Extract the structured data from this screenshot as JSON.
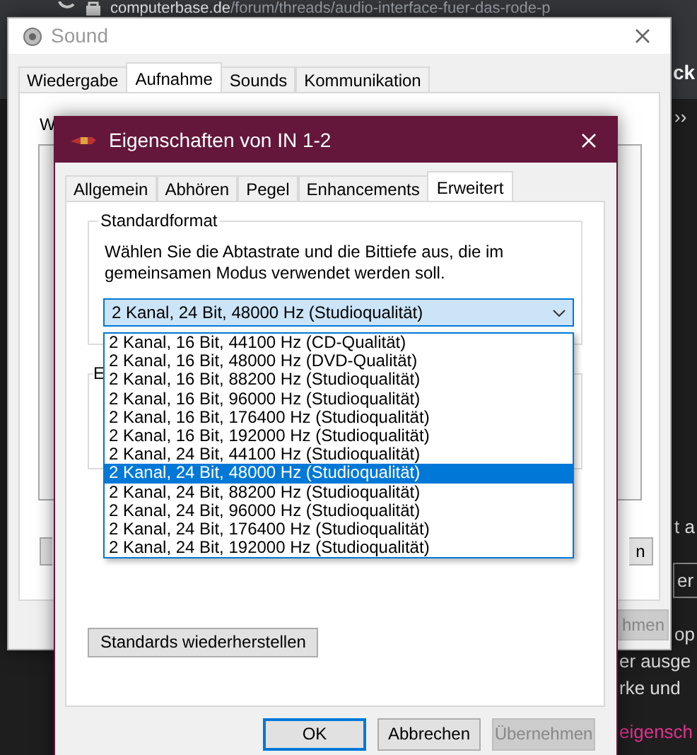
{
  "browser": {
    "url_host": "computerbase.de",
    "url_path": "/forum/threads/audio-interface-fuer-das-rode-p"
  },
  "background_page": {
    "fragments": [
      {
        "text": "ck",
        "kind": "heading"
      },
      {
        "text": "››",
        "kind": "text"
      },
      {
        "text": "t a",
        "kind": "text"
      },
      {
        "text": "er",
        "kind": "field"
      },
      {
        "text": "op",
        "kind": "text"
      },
      {
        "text": "er ausge",
        "kind": "text"
      },
      {
        "text": "rke und",
        "kind": "text"
      },
      {
        "text": "eigensch",
        "kind": "link"
      }
    ]
  },
  "sound_window": {
    "title": "Sound",
    "tabs": [
      {
        "label": "Wiedergabe",
        "selected": false
      },
      {
        "label": "Aufnahme",
        "selected": true
      },
      {
        "label": "Sounds",
        "selected": false
      },
      {
        "label": "Kommunikation",
        "selected": false
      }
    ],
    "instruction": "W",
    "side_buttons": [
      "n"
    ],
    "footer_buttons": [
      {
        "label": "hmen",
        "disabled": true
      }
    ]
  },
  "dialog": {
    "title": "Eigenschaften von IN 1-2",
    "tabs": [
      {
        "label": "Allgemein",
        "selected": false
      },
      {
        "label": "Abhören",
        "selected": false
      },
      {
        "label": "Pegel",
        "selected": false
      },
      {
        "label": "Enhancements",
        "selected": false
      },
      {
        "label": "Erweitert",
        "selected": true
      }
    ],
    "format_group": {
      "title": "Standardformat",
      "description": "Wählen Sie die Abtastrate und die Bittiefe aus, die im gemeinsamen Modus verwendet werden soll.",
      "format_select": {
        "value": "2 Kanal, 24 Bit, 48000 Hz (Studioqualität)",
        "expanded": true,
        "options": [
          {
            "label": "2 Kanal, 16 Bit, 44100 Hz (CD-Qualität)",
            "selected": false
          },
          {
            "label": "2 Kanal, 16 Bit, 48000 Hz (DVD-Qualität)",
            "selected": false
          },
          {
            "label": "2 Kanal, 16 Bit, 88200 Hz (Studioqualität)",
            "selected": false
          },
          {
            "label": "2 Kanal, 16 Bit, 96000 Hz (Studioqualität)",
            "selected": false
          },
          {
            "label": "2 Kanal, 16 Bit, 176400 Hz (Studioqualität)",
            "selected": false
          },
          {
            "label": "2 Kanal, 16 Bit, 192000 Hz (Studioqualität)",
            "selected": false
          },
          {
            "label": "2 Kanal, 24 Bit, 44100 Hz (Studioqualität)",
            "selected": false
          },
          {
            "label": "2 Kanal, 24 Bit, 48000 Hz (Studioqualität)",
            "selected": true
          },
          {
            "label": "2 Kanal, 24 Bit, 88200 Hz (Studioqualität)",
            "selected": false
          },
          {
            "label": "2 Kanal, 24 Bit, 96000 Hz (Studioqualität)",
            "selected": false
          },
          {
            "label": "2 Kanal, 24 Bit, 176400 Hz (Studioqualität)",
            "selected": false
          },
          {
            "label": "2 Kanal, 24 Bit, 192000 Hz (Studioqualität)",
            "selected": false
          }
        ]
      }
    },
    "second_group": {
      "title": "E"
    },
    "restore_button": "Standards wiederherstellen",
    "buttons": [
      {
        "label": "OK",
        "default": true,
        "disabled": false
      },
      {
        "label": "Abbrechen",
        "default": false,
        "disabled": false
      },
      {
        "label": "Übernehmen",
        "default": false,
        "disabled": true
      }
    ]
  }
}
